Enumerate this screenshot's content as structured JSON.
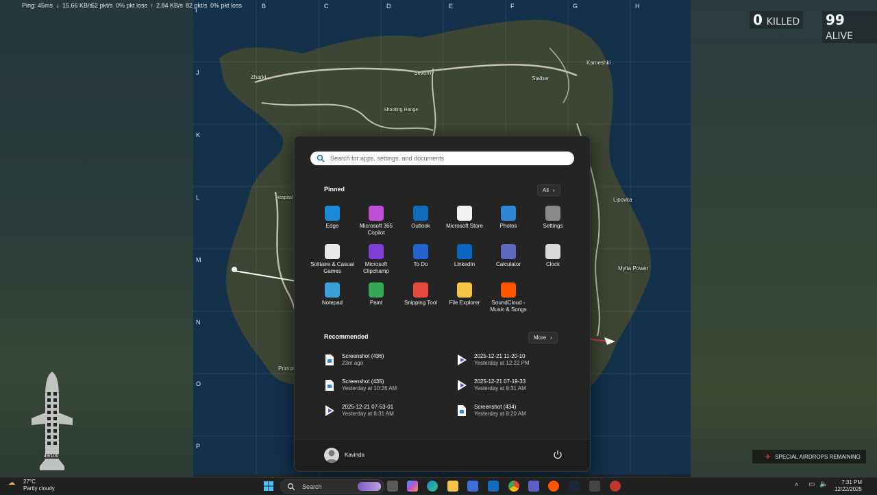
{
  "hud": {
    "ping": "Ping: 45ms",
    "down_rate": "15.66 KB/s",
    "down_pkts": "52 pkt/s",
    "down_loss": "0% pkt loss",
    "up_rate": "2.84 KB/s",
    "up_pkts": "82 pkt/s",
    "up_loss": "0% pkt loss",
    "killed_count": "0",
    "killed_label": "KILLED",
    "alive_count": "99",
    "alive_label": "ALIVE",
    "plane_capacity": "49/100",
    "airdrops_label": "SPECIAL AIRDROPS REMAINING"
  },
  "map": {
    "columns": [
      "I",
      "B",
      "C",
      "D",
      "E",
      "F",
      "G",
      "H"
    ],
    "rows": [
      "J",
      "K",
      "L",
      "M",
      "N",
      "O",
      "P"
    ],
    "towns": [
      "Zharki",
      "Severny",
      "Stalber",
      "Kameshki",
      "Shooting Range",
      "Hospital",
      "Lipovka",
      "Mylta Power",
      "Primorsk"
    ]
  },
  "start_menu": {
    "search_placeholder": "Search for apps, settings, and documents",
    "pinned_title": "Pinned",
    "all_label": "All",
    "pinned": [
      {
        "label": "Edge",
        "icon": "edge-icon",
        "color": "#1b8ad6"
      },
      {
        "label": "Microsoft 365 Copilot",
        "icon": "copilot-icon",
        "color": "#c04fd8"
      },
      {
        "label": "Outlook",
        "icon": "outlook-icon",
        "color": "#0f6cbd"
      },
      {
        "label": "Microsoft Store",
        "icon": "store-icon",
        "color": "#f2f2f2"
      },
      {
        "label": "Photos",
        "icon": "photos-icon",
        "color": "#2f86d4"
      },
      {
        "label": "Settings",
        "icon": "settings-icon",
        "color": "#8a8a8a"
      },
      {
        "label": "Solitaire & Casual Games",
        "icon": "solitaire-icon",
        "color": "#e9e9e9"
      },
      {
        "label": "Microsoft Clipchamp",
        "icon": "clipchamp-icon",
        "color": "#7e3fd6"
      },
      {
        "label": "To Do",
        "icon": "todo-icon",
        "color": "#2564cf"
      },
      {
        "label": "LinkedIn",
        "icon": "linkedin-icon",
        "color": "#0a66c2"
      },
      {
        "label": "Calculator",
        "icon": "calculator-icon",
        "color": "#5c6bc0"
      },
      {
        "label": "Clock",
        "icon": "clock-icon",
        "color": "#d9d9d9"
      },
      {
        "label": "Notepad",
        "icon": "notepad-icon",
        "color": "#3aa0d8"
      },
      {
        "label": "Paint",
        "icon": "paint-icon",
        "color": "#34a853"
      },
      {
        "label": "Snipping Tool",
        "icon": "snipping-tool-icon",
        "color": "#e64a3c"
      },
      {
        "label": "File Explorer",
        "icon": "file-explorer-icon",
        "color": "#f4c542"
      },
      {
        "label": "SoundCloud - Music & Songs",
        "icon": "soundcloud-icon",
        "color": "#ff5500"
      }
    ],
    "recommended_title": "Recommended",
    "more_label": "More",
    "recommended": [
      {
        "name": "Screenshot (436)",
        "time": "23m ago",
        "type": "image"
      },
      {
        "name": "2025-12-21 11-20-10",
        "time": "Yesterday at 12:22 PM",
        "type": "video"
      },
      {
        "name": "Screenshot (435)",
        "time": "Yesterday at 10:26 AM",
        "type": "image"
      },
      {
        "name": "2025-12-21 07-19-33",
        "time": "Yesterday at 8:31 AM",
        "type": "video"
      },
      {
        "name": "2025-12-21 07-53-01",
        "time": "Yesterday at 8:31 AM",
        "type": "video"
      },
      {
        "name": "Screenshot (434)",
        "time": "Yesterday at 8:20 AM",
        "type": "image"
      }
    ],
    "user_name": "Kavinda"
  },
  "taskbar": {
    "search_label": "Search",
    "temperature": "27°C",
    "weather": "Partly cloudy",
    "time": "7:31 PM",
    "date": "12/22/2025"
  }
}
